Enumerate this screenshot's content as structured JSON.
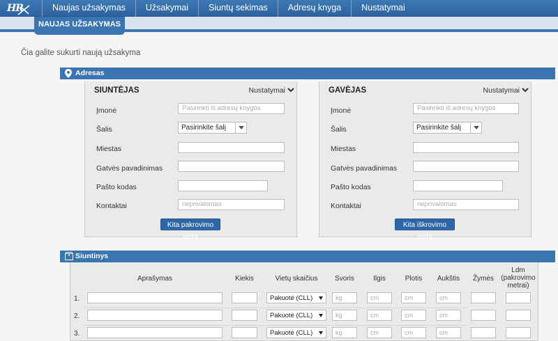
{
  "nav": {
    "logo": "HR",
    "items": [
      "Naujas užsakymas",
      "Užsakymai",
      "Siuntų sekimas",
      "Adresų knyga",
      "Nustatymai"
    ]
  },
  "subnav": {
    "active_tab": "NAUJAS UŽSAKYMAS"
  },
  "page": {
    "title": "Čia galite sukurti naują užsakyma"
  },
  "address_section": {
    "title": "Adresas",
    "icon": "map-pin-icon"
  },
  "sender": {
    "title": "SIUNTĖJAS",
    "settings": "Nustatymai",
    "labels": [
      "Įmonė",
      "Šalis",
      "Miestas",
      "Gatvės pavadinimas",
      "Pašto kodas",
      "Kontaktai"
    ],
    "company_placeholder": "Pasirinkti iš adresų knygos",
    "country_value": "Pasirinkite šalį",
    "contacts_placeholder": "neprivalomas",
    "button": "Kita pakrovimo vieta"
  },
  "receiver": {
    "title": "GAVĖJAS",
    "settings": "Nustatymai",
    "labels": [
      "Įmonė",
      "Šalis",
      "Miestas",
      "Gatvės pavadinimas",
      "Pašto kodas",
      "Kontaktai"
    ],
    "company_placeholder": "Pasirinkti iš adresų knygos",
    "country_value": "Pasirinkite šalį",
    "contacts_placeholder": "neprivalomas",
    "button": "Kita iškrovimo vieta"
  },
  "shipment_section": {
    "title": "Siuntinys",
    "icon": "package-icon"
  },
  "shipment_table": {
    "headers": [
      "Aprašymas",
      "Kiekis",
      "Vietų skaičius",
      "Svoris",
      "Ilgis",
      "Plotis",
      "Aukštis",
      "Žymės",
      "Ldm (pakrovimo metrai)"
    ],
    "rows": [
      {
        "num": "1.",
        "packaging": "Pakuotė (CLL)",
        "weight_ph": "kg",
        "length_ph": "cm",
        "width_ph": "cm",
        "height_ph": "cm"
      },
      {
        "num": "2.",
        "packaging": "Pakuotė (CLL)",
        "weight_ph": "kg",
        "length_ph": "cm",
        "width_ph": "cm",
        "height_ph": "cm"
      },
      {
        "num": "3.",
        "packaging": "Pakuotė (CLL)",
        "weight_ph": "kg",
        "length_ph": "cm",
        "width_ph": "cm",
        "height_ph": "cm"
      }
    ]
  },
  "colors": {
    "primary": "#3a75b2",
    "button": "#2f66a6",
    "panel": "#eaeaea"
  }
}
